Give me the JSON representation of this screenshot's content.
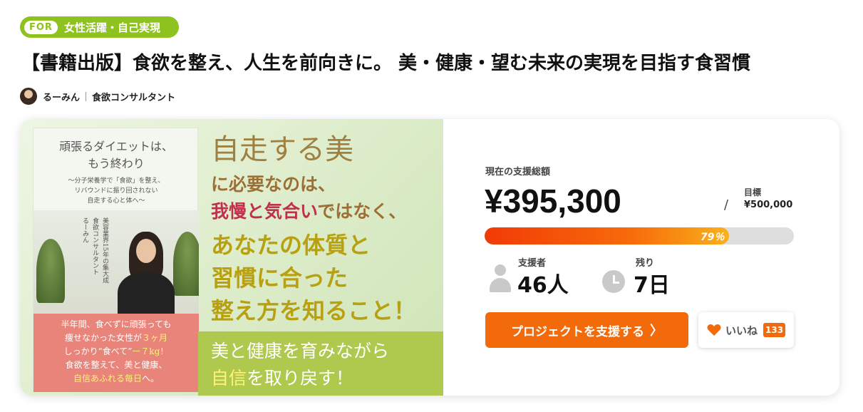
{
  "category_tag": {
    "prefix": "FOR",
    "label": "女性活躍・自己実現",
    "color": "#8dc21f"
  },
  "project": {
    "title": "【書籍出版】食欲を整え、人生を前向きに。 美・健康・望む未来の実現を目指す食習慣",
    "owner_name": "るーみん",
    "owner_role": "食欲コンサルタント"
  },
  "banner": {
    "book": {
      "title_line1": "頑張るダイエットは、",
      "title_line2": "もう終わり",
      "subtitle_line1": "〜分子栄養学で「食欲」を整え、",
      "subtitle_line2": "リバウンドに振り回されない",
      "subtitle_line3": "自走する心と体へ〜",
      "vertical_1": "美容業界15年の集大成",
      "vertical_2": "食欲コンサルタント",
      "vertical_3": "るーみん",
      "red_line1": "半年間、食べずに頑張っても",
      "red_line2a": "痩せなかった女性が",
      "red_line2b": "３ヶ月",
      "red_line3a": "しっかり“食べて”",
      "red_line3b": "ー７kg！",
      "red_line4": "食欲を整えて、美と健康、",
      "red_line5a": "自信あふれる毎日",
      "red_line5b": "へ。"
    },
    "line1": "自走する美",
    "line2": "に必要なのは、",
    "line3_red": "我慢と気合い",
    "line3_rest": "ではなく、",
    "line4": "あなたの体質と",
    "line5": "習慣に合った",
    "line6": "整え方を知ること！",
    "band_line1": "美と健康を育みながら",
    "band_line2_hl": "自信",
    "band_line2_rest": "を取り戻す！"
  },
  "funding": {
    "total_label": "現在の支援総額",
    "total_amount": "¥395,300",
    "slash": "/",
    "goal_label": "目標",
    "goal_amount": "¥500,000",
    "progress_percent": 79,
    "progress_label": "79％",
    "backers_label": "支援者",
    "backers_value": "46人",
    "remaining_label": "残り",
    "remaining_value": "7日"
  },
  "actions": {
    "support_label": "プロジェクトを支援する",
    "support_chevron": "〉",
    "like_label": "いいね",
    "like_count": "133"
  },
  "colors": {
    "accent": "#f26a0a",
    "progress_start": "#f13b07",
    "progress_end": "#fab11c"
  }
}
